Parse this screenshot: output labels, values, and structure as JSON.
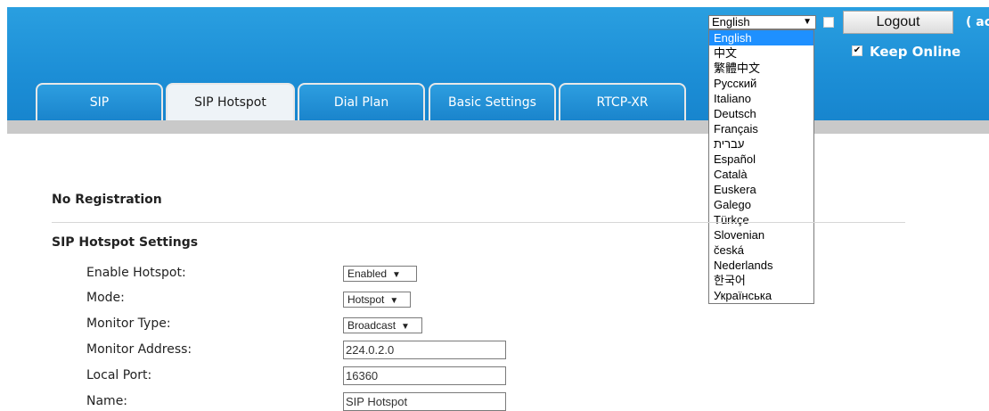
{
  "header": {
    "language_selected": "English",
    "logout_label": "Logout",
    "user_text": "( ac",
    "keep_online_label": "Keep Online",
    "keep_online_checked": true
  },
  "language_options": [
    "English",
    "中文",
    "繁體中文",
    "Русский",
    "Italiano",
    "Deutsch",
    "Français",
    "עברית",
    "Español",
    "Català",
    "Euskera",
    "Galego",
    "Türkçe",
    "Slovenian",
    "česká",
    "Nederlands",
    "한국어",
    "Українська"
  ],
  "tabs": [
    "SIP",
    "SIP Hotspot",
    "Dial Plan",
    "Basic Settings",
    "RTCP-XR"
  ],
  "active_tab": "SIP Hotspot",
  "main": {
    "registration_status": "No Registration",
    "section_title": "SIP Hotspot Settings",
    "fields": [
      {
        "label": "Enable Hotspot:",
        "value": "Enabled"
      },
      {
        "label": "Mode:",
        "value": "Hotspot"
      },
      {
        "label": "Monitor Type:",
        "value": "Broadcast"
      },
      {
        "label": "Monitor Address:",
        "value": "224.0.2.0"
      },
      {
        "label": "Local Port:",
        "value": "16360"
      },
      {
        "label": "Name:",
        "value": "SIP Hotspot"
      }
    ]
  }
}
